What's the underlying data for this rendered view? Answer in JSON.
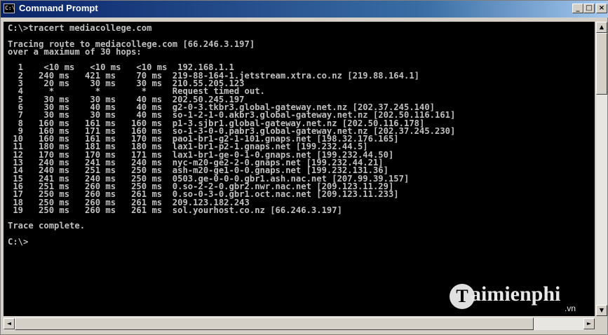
{
  "window": {
    "title": "Command Prompt",
    "icon": "C:\\",
    "buttons": {
      "minimize": "_",
      "maximize": "□",
      "close": "×"
    }
  },
  "console": {
    "lines": [
      "C:\\>tracert mediacollege.com",
      "",
      "Tracing route to mediacollege.com [66.246.3.197]",
      "over a maximum of 30 hops:",
      "",
      "  1    <10 ms   <10 ms   <10 ms  192.168.1.1",
      "  2   240 ms   421 ms    70 ms  219-88-164-1.jetstream.xtra.co.nz [219.88.164.1]",
      "  3    20 ms    30 ms    30 ms  210.55.205.123",
      "  4     *        *        *     Request timed out.",
      "  5    30 ms    30 ms    40 ms  202.50.245.197",
      "  6    30 ms    40 ms    40 ms  g2-0-3.tkbr3.global-gateway.net.nz [202.37.245.140]",
      "  7    30 ms    30 ms    40 ms  so-1-2-1-0.akbr3.global-gateway.net.nz [202.50.116.161]",
      "  8   160 ms   161 ms   160 ms  p1-3.sjbr1.global-gateway.net.nz [202.50.116.178]",
      "  9   160 ms   171 ms   160 ms  so-1-3-0-0.pabr3.global-gateway.net.nz [202.37.245.230]",
      " 10   160 ms   161 ms   170 ms  pao1-br1-g2-1-101.gnaps.net [198.32.176.165]",
      " 11   180 ms   181 ms   180 ms  lax1-br1-p2-1.gnaps.net [199.232.44.5]",
      " 12   170 ms   170 ms   171 ms  lax1-br1-ge-0-1-0.gnaps.net [199.232.44.50]",
      " 13   240 ms   241 ms   240 ms  nyc-m20-ge2-2-0.gnaps.net [199.232.44.21]",
      " 14   240 ms   251 ms   250 ms  ash-m20-ge1-0-0.gnaps.net [199.232.131.36]",
      " 15   241 ms   240 ms   250 ms  0503.ge-0-0-0.gbr1.ash.nac.net [207.99.39.157]",
      " 16   251 ms   260 ms   250 ms  0.so-2-2-0.gbr2.nwr.nac.net [209.123.11.29]",
      " 17   250 ms   260 ms   261 ms  0.so-0-3-0.gbr1.oct.nac.net [209.123.11.233]",
      " 18   250 ms   260 ms   261 ms  209.123.182.243",
      " 19   250 ms   260 ms   261 ms  sol.yourhost.co.nz [66.246.3.197]",
      "",
      "Trace complete.",
      "",
      "C:\\>"
    ]
  },
  "scrollbars": {
    "up": "▲",
    "down": "▼",
    "left": "◄",
    "right": "►"
  },
  "watermark": {
    "logo": "T",
    "text": "aimienphi",
    "suffix": ".vn"
  }
}
